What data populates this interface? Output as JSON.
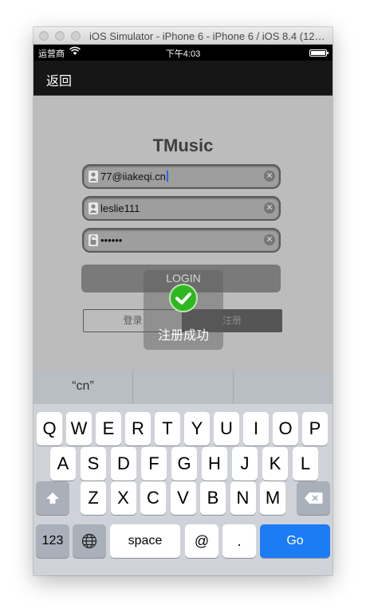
{
  "window": {
    "title": "iOS Simulator - iPhone 6 - iPhone 6 / iOS 8.4 (12H141)"
  },
  "status_bar": {
    "carrier": "运营商",
    "time": "下午4:03",
    "battery_level": 1.0
  },
  "nav": {
    "back_label": "返回"
  },
  "app": {
    "title": "TMusic",
    "fields": [
      {
        "icon": "user-icon",
        "value": "77@iiakeqi.cn"
      },
      {
        "icon": "user-icon",
        "value": "leslie111"
      },
      {
        "icon": "lock-icon",
        "value": "••••••"
      }
    ],
    "login_label": "LOGIN",
    "segments": [
      "登录",
      "注册"
    ]
  },
  "hud": {
    "icon": "checkmark-icon",
    "message": "注册成功"
  },
  "keyboard": {
    "suggestions": [
      "“cn”",
      "",
      ""
    ],
    "row1": [
      "Q",
      "W",
      "E",
      "R",
      "T",
      "Y",
      "U",
      "I",
      "O",
      "P"
    ],
    "row2": [
      "A",
      "S",
      "D",
      "F",
      "G",
      "H",
      "J",
      "K",
      "L"
    ],
    "row3": [
      "Z",
      "X",
      "C",
      "V",
      "B",
      "N",
      "M"
    ],
    "numbers_label": "123",
    "space_label": "space",
    "at_label": "@",
    "dot_label": ".",
    "go_label": "Go"
  }
}
